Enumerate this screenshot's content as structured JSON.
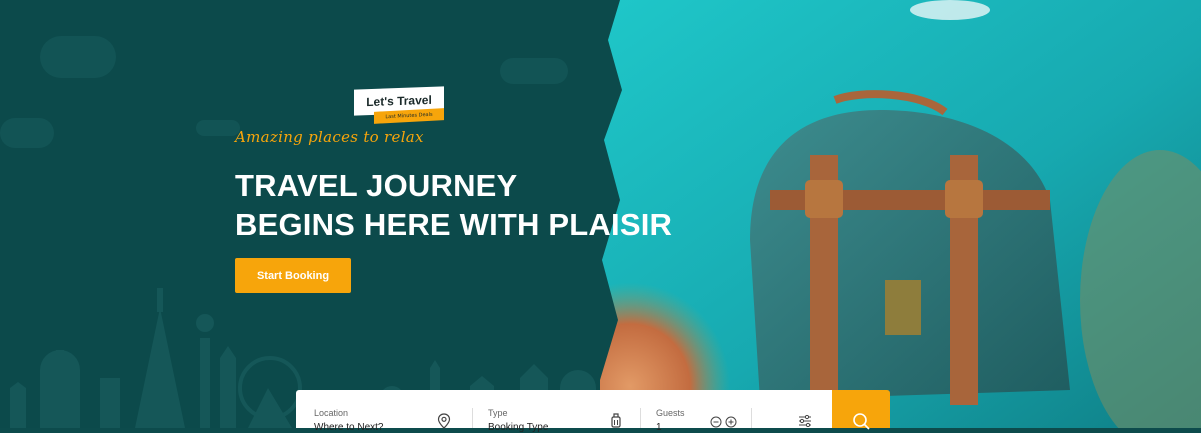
{
  "logo": {
    "name": "Let's Travel",
    "subtitle": "Last Minutes Deals"
  },
  "hero": {
    "tagline": "Amazing places to relax",
    "headline_line1": "TRAVEL JOURNEY",
    "headline_line2": "BEGINS HERE WITH PLAISIR",
    "cta_label": "Start Booking"
  },
  "booking": {
    "location_label": "Location",
    "location_value": "Where to Next?",
    "type_label": "Type",
    "type_value": "Booking Type",
    "guests_label": "Guests",
    "guests_value": "1"
  },
  "colors": {
    "accent": "#f7a50b",
    "background": "#0c4a4b",
    "text": "#ffffff"
  },
  "icons": {
    "location": "map-pin-icon",
    "type": "luggage-icon",
    "guests_minus": "minus-circle-icon",
    "guests_plus": "plus-circle-icon",
    "filters": "sliders-icon",
    "search": "search-icon"
  }
}
